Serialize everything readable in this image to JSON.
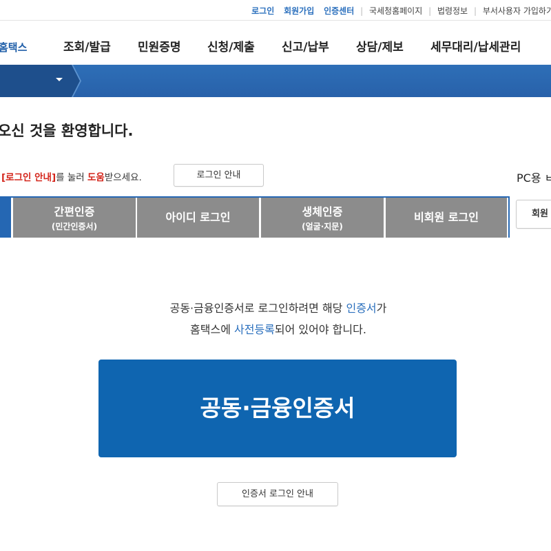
{
  "utility_links": {
    "login": "로그인",
    "signup": "회원가입",
    "cert_center": "인증센터",
    "nts_home": "국세청홈페이지",
    "law_info": "법령정보",
    "dept_user": "부서사용자 가입하기"
  },
  "brand": {
    "logo_text": "홈택스"
  },
  "nav": {
    "items": [
      "조회/발급",
      "민원증명",
      "신청/제출",
      "신고/납부",
      "상담/제보",
      "세무대리/납세관리"
    ]
  },
  "welcome": {
    "text": "오신 것을 환영합니다."
  },
  "help": {
    "prefix": "[로그인 안내]",
    "middle1": "를 눌러 ",
    "emph": "도움",
    "suffix": "받으세요.",
    "button_label": "로그인 안내"
  },
  "pc_label": "PC용 ㅂ",
  "member_button": "회원",
  "tabs": [
    {
      "label": "간편인증",
      "sub": "(민간인증서)"
    },
    {
      "label": "아이디 로그인",
      "sub": ""
    },
    {
      "label": "생체인증",
      "sub": "(얼굴·지문)"
    },
    {
      "label": "비회원 로그인",
      "sub": ""
    }
  ],
  "info": {
    "line1_a": "공동·금융인증서로 로그인하려면 해당 ",
    "line1_b": "인증서",
    "line1_c": "가",
    "line2_a": "홈택스에 ",
    "line2_b": "사전등록",
    "line2_c": "되어 있어야 합니다."
  },
  "cert_button": "공동·금융인증서",
  "cert_guide_button": "인증서 로그인 안내",
  "colors": {
    "brand_blue": "#1f5ea8",
    "band_blue": "#2e6fb7",
    "tab_gray": "#8c8c8c",
    "cert_blue": "#0f65b0",
    "accent_red": "#d4251b"
  }
}
